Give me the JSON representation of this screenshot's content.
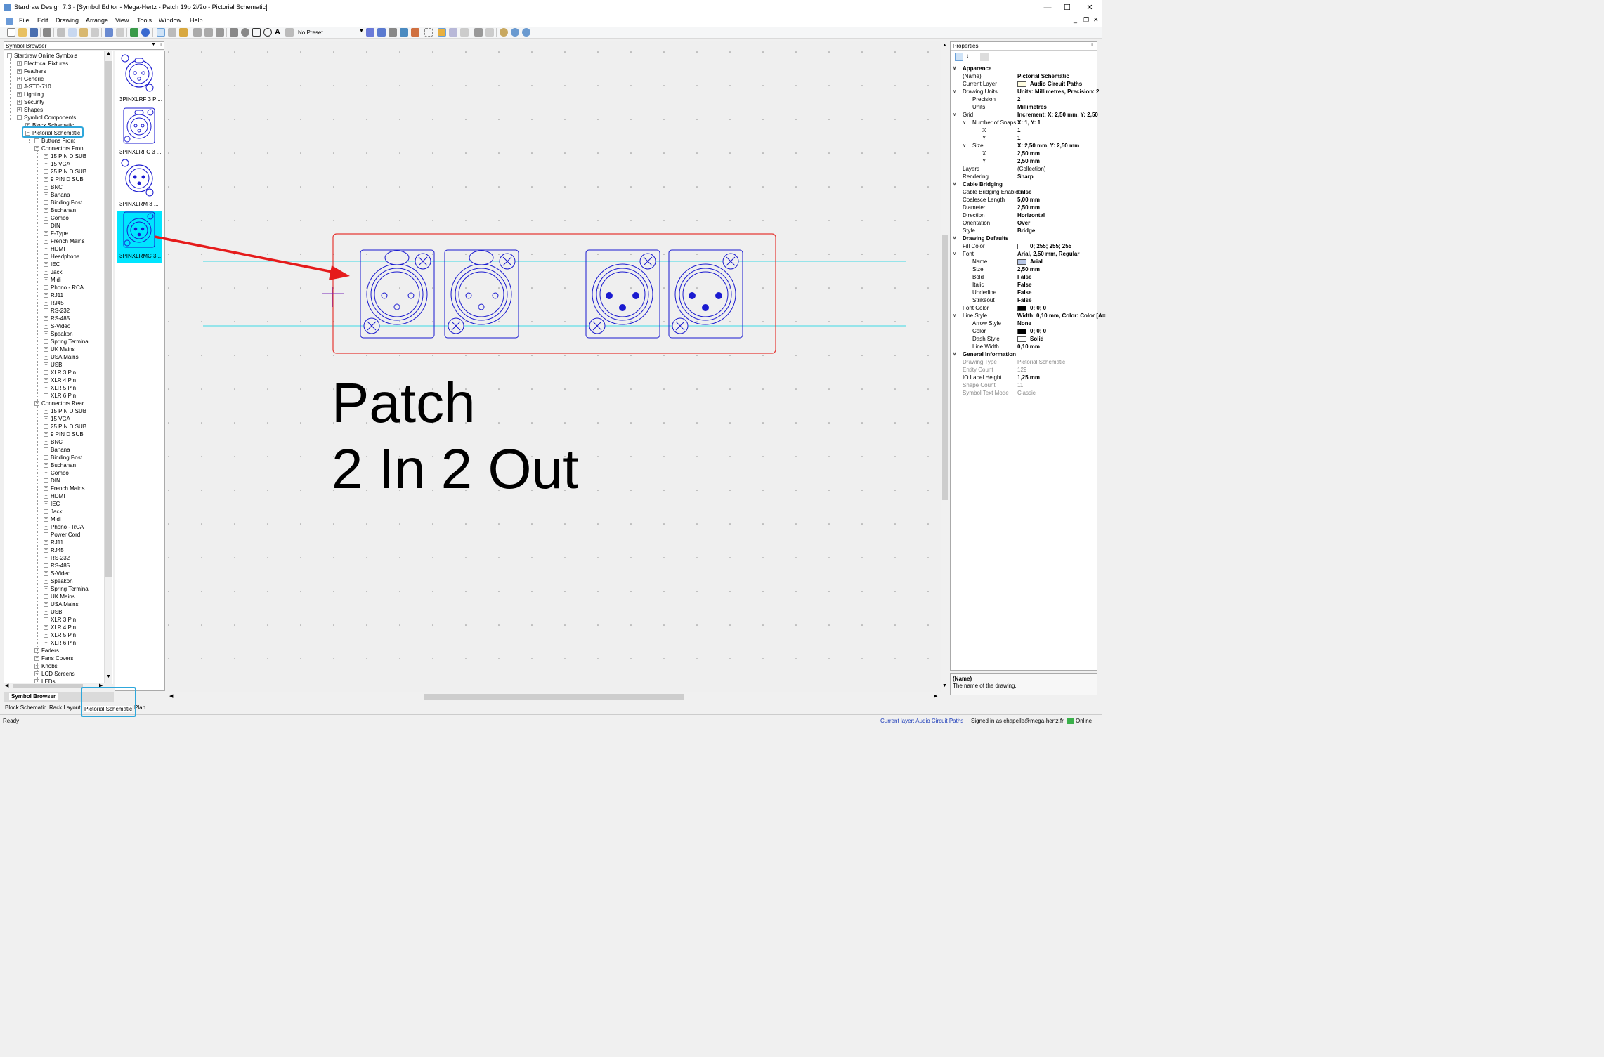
{
  "window": {
    "title": "Stardraw Design 7.3 - [Symbol Editor - Mega-Hertz - Patch 19p 2i/2o - Pictorial Schematic]",
    "min": "—",
    "max": "☐",
    "close": "✕",
    "inner_min": "_",
    "inner_restore": "❐",
    "inner_close": "✕"
  },
  "menu": [
    "File",
    "Edit",
    "Drawing",
    "Arrange",
    "View",
    "Tools",
    "Window",
    "Help"
  ],
  "toolbar": {
    "preset": "No Preset"
  },
  "symbol_browser": {
    "title": "Symbol Browser",
    "pin": "⊥",
    "root": "Stardraw Online Symbols",
    "level1": [
      "Electrical Fixtures",
      "Feathers",
      "Generic",
      "J-STD-710",
      "Lighting",
      "Security",
      "Shapes"
    ],
    "symbol_components": "Symbol Components",
    "block_schematic": "Block Schematic",
    "pictorial_schematic": "Pictorial Schematic",
    "buttons_front": "Buttons Front",
    "connectors_front": "Connectors Front",
    "front_items": [
      "15 PIN D SUB",
      "15 VGA",
      "25 PIN D SUB",
      "9 PIN D SUB",
      "BNC",
      "Banana",
      "Binding Post",
      "Buchanan",
      "Combo",
      "DIN",
      "F-Type",
      "French Mains",
      "HDMI",
      "Headphone",
      "IEC",
      "Jack",
      "Midi",
      "Phono - RCA",
      "RJ11",
      "RJ45",
      "RS-232",
      "RS-485",
      "S-Video",
      "Speakon",
      "Spring Terminal",
      "UK Mains",
      "USA Mains",
      "USB",
      "XLR 3 Pin",
      "XLR 4 Pin",
      "XLR 5 Pin",
      "XLR 6 Pin"
    ],
    "connectors_rear": "Connectors Rear",
    "rear_items": [
      "15 PIN D SUB",
      "15 VGA",
      "25 PIN D SUB",
      "9 PIN D SUB",
      "BNC",
      "Banana",
      "Binding Post",
      "Buchanan",
      "Combo",
      "DIN",
      "French Mains",
      "HDMI",
      "IEC",
      "Jack",
      "Midi",
      "Phono - RCA",
      "Power Cord",
      "RJ11",
      "RJ45",
      "RS-232",
      "RS-485",
      "S-Video",
      "Speakon",
      "Spring Terminal",
      "UK Mains",
      "USA Mains",
      "USB",
      "XLR 3 Pin",
      "XLR 4 Pin",
      "XLR 5 Pin",
      "XLR 6 Pin"
    ],
    "after_items": [
      "Faders",
      "Fans Covers",
      "Knobs",
      "LCD Screens",
      "LEDs"
    ],
    "thumbnails": [
      "3PINXLRF 3 Pi...",
      "3PINXLRFC 3 ...",
      "3PINXLRM 3 ...",
      "3PINXLRMC 3..."
    ],
    "tab": "Symbol Browser"
  },
  "bottom_tabs": [
    "Block Schematic",
    "Rack Layout",
    "Pictorial Schematic",
    "Plan"
  ],
  "canvas": {
    "line1": "Patch",
    "line2": "2 In 2 Out"
  },
  "properties": {
    "title": "Properties",
    "rows": [
      {
        "cat": true,
        "k": "Apparence",
        "tog": "∨"
      },
      {
        "k": "(Name)",
        "v": "Pictorial Schematic"
      },
      {
        "k": "Current Layer",
        "v": "Audio Circuit Paths",
        "sw": "#fffde0"
      },
      {
        "k": "Drawing Units",
        "v": "Units: Millimetres, Precision: 2",
        "tog": "∨"
      },
      {
        "k": "Precision",
        "v": "2",
        "ind": 1
      },
      {
        "k": "Units",
        "v": "Millimetres",
        "ind": 1
      },
      {
        "k": "Grid",
        "v": "Increment: X: 2,50 mm, Y: 2,50",
        "tog": "∨"
      },
      {
        "k": "Number of Snaps",
        "v": "X: 1, Y: 1",
        "ind": 1,
        "tog": "∨"
      },
      {
        "k": "X",
        "v": "1",
        "ind": 2
      },
      {
        "k": "Y",
        "v": "1",
        "ind": 2
      },
      {
        "k": "Size",
        "v": "X: 2,50 mm, Y: 2,50 mm",
        "ind": 1,
        "tog": "∨"
      },
      {
        "k": "X",
        "v": "2,50 mm",
        "ind": 2
      },
      {
        "k": "Y",
        "v": "2,50 mm",
        "ind": 2
      },
      {
        "k": "Layers",
        "v": "(Collection)",
        "plain": true
      },
      {
        "k": "Rendering",
        "v": "Sharp"
      },
      {
        "cat": true,
        "k": "Cable Bridging",
        "tog": "∨"
      },
      {
        "k": "Cable Bridging Enabled",
        "v": "False"
      },
      {
        "k": "Coalesce Length",
        "v": "5,00 mm"
      },
      {
        "k": "Diameter",
        "v": "2,50 mm"
      },
      {
        "k": "Direction",
        "v": "Horizontal"
      },
      {
        "k": "Orientation",
        "v": "Over"
      },
      {
        "k": "Style",
        "v": "Bridge"
      },
      {
        "cat": true,
        "k": "Drawing Defaults",
        "tog": "∨"
      },
      {
        "k": "Fill Color",
        "v": "0; 255; 255; 255",
        "sw": "#ffffff"
      },
      {
        "k": "Font",
        "v": "Arial, 2,50 mm, Regular",
        "tog": "∨"
      },
      {
        "k": "Name",
        "v": "Arial",
        "ind": 1,
        "sw": "#b8c8e8"
      },
      {
        "k": "Size",
        "v": "2,50 mm",
        "ind": 1
      },
      {
        "k": "Bold",
        "v": "False",
        "ind": 1
      },
      {
        "k": "Italic",
        "v": "False",
        "ind": 1
      },
      {
        "k": "Underline",
        "v": "False",
        "ind": 1
      },
      {
        "k": "Strikeout",
        "v": "False",
        "ind": 1
      },
      {
        "k": "Font Color",
        "v": "0; 0; 0",
        "sw": "#000000"
      },
      {
        "k": "Line Style",
        "v": "Width: 0,10 mm, Color: Color [A=",
        "tog": "∨"
      },
      {
        "k": "Arrow Style",
        "v": "None",
        "ind": 1
      },
      {
        "k": "Color",
        "v": "0; 0; 0",
        "ind": 1,
        "sw": "#000000"
      },
      {
        "k": "Dash Style",
        "v": "Solid",
        "ind": 1,
        "sw": "#ffffff"
      },
      {
        "k": "Line Width",
        "v": "0,10 mm",
        "ind": 1
      },
      {
        "cat": true,
        "k": "General Information",
        "tog": "∨"
      },
      {
        "k": "Drawing Type",
        "v": "Pictorial Schematic",
        "gray": true
      },
      {
        "k": "Entity Count",
        "v": "129",
        "gray": true
      },
      {
        "k": "IO Label Height",
        "v": "1,25 mm"
      },
      {
        "k": "Shape Count",
        "v": "11",
        "gray": true
      },
      {
        "k": "Symbol Text Mode",
        "v": "Classic",
        "gray": true
      }
    ],
    "desc_title": "(Name)",
    "desc_text": "The name of the drawing."
  },
  "status": {
    "left": "Ready",
    "layer": "Current layer: Audio Circuit Paths",
    "signed": "Signed in as chapelle@mega-hertz.fr",
    "online": "Online"
  },
  "colors": {
    "accent": "#2ea7db",
    "selection": "#00e5ff",
    "frame": "#e53935",
    "symbol": "#1a1ad0",
    "arrow": "#e51b1b",
    "layer": "#1a3ab8"
  }
}
